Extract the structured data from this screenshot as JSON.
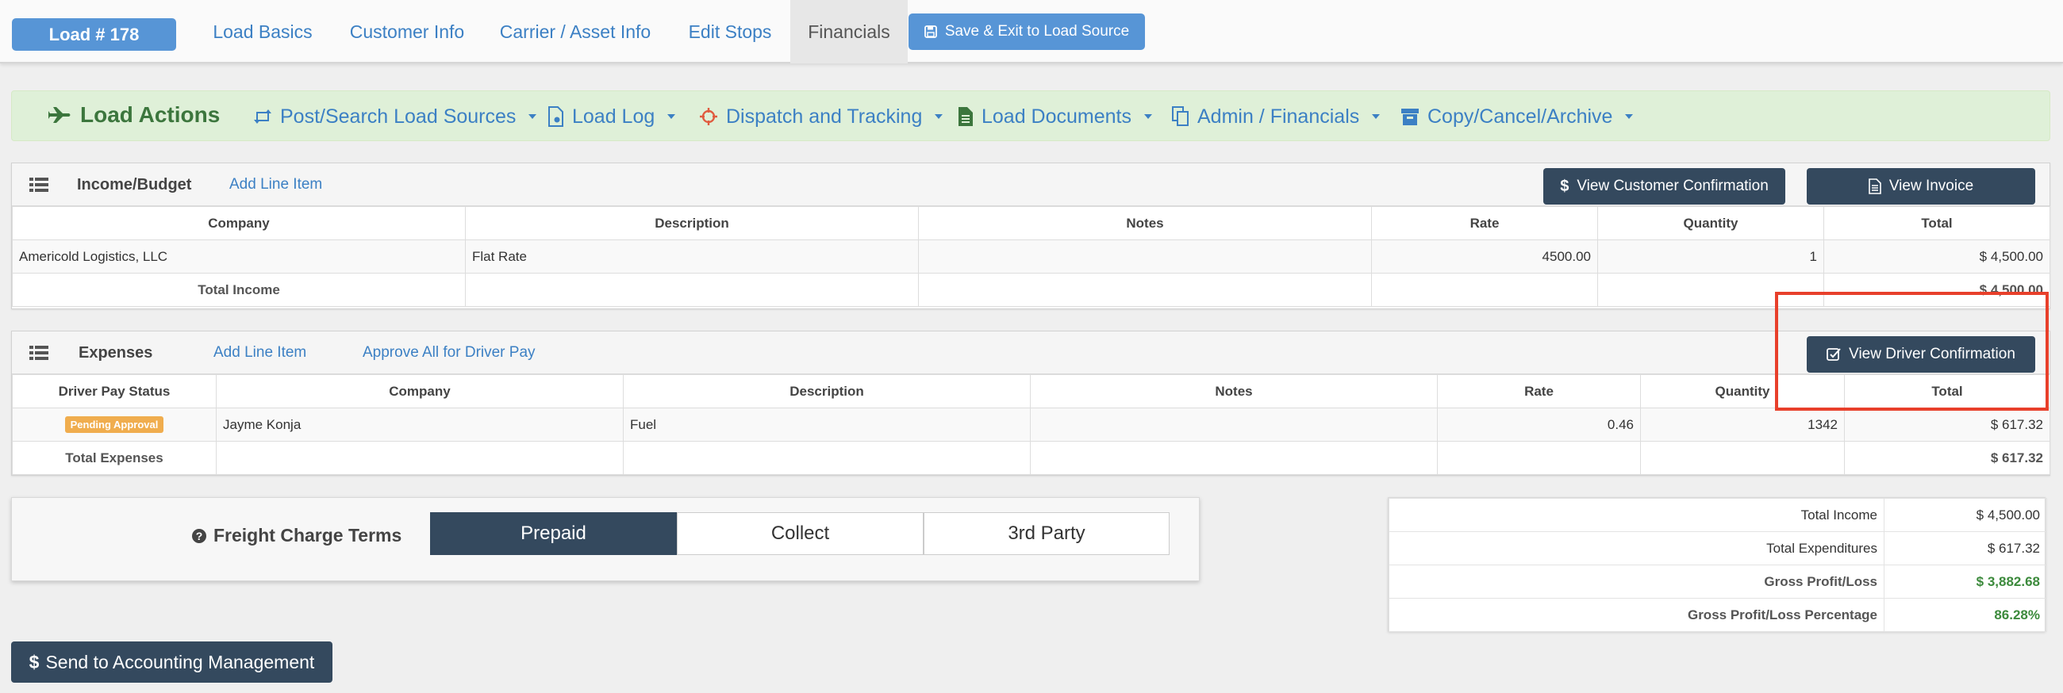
{
  "topnav": {
    "load_badge": "Load # 178",
    "tabs": [
      "Load Basics",
      "Customer Info",
      "Carrier / Asset Info",
      "Edit Stops",
      "Financials"
    ],
    "active_tab": "Financials",
    "save_exit": "Save & Exit to Load Source"
  },
  "load_actions": {
    "title": "Load Actions",
    "items": [
      "Post/Search Load Sources",
      "Load Log",
      "Dispatch and Tracking",
      "Load Documents",
      "Admin / Financials",
      "Copy/Cancel/Archive"
    ]
  },
  "income": {
    "title": "Income/Budget",
    "add_line": "Add Line Item",
    "view_customer_conf": "View Customer Confirmation",
    "view_invoice": "View Invoice",
    "columns": [
      "Company",
      "Description",
      "Notes",
      "Rate",
      "Quantity",
      "Total"
    ],
    "rows": [
      {
        "company": "Americold Logistics, LLC",
        "description": "Flat Rate",
        "notes": "",
        "rate": "4500.00",
        "quantity": "1",
        "total": "$ 4,500.00"
      }
    ],
    "footer_label": "Total Income",
    "footer_total": "$ 4,500.00"
  },
  "expenses": {
    "title": "Expenses",
    "add_line": "Add Line Item",
    "approve_all": "Approve All for Driver Pay",
    "view_driver_conf": "View Driver Confirmation",
    "columns": [
      "Driver Pay Status",
      "Company",
      "Description",
      "Notes",
      "Rate",
      "Quantity",
      "Total"
    ],
    "rows": [
      {
        "status": "Pending Approval",
        "company": "Jayme Konja",
        "description": "Fuel",
        "notes": "",
        "rate": "0.46",
        "quantity": "1342",
        "total": "$ 617.32"
      }
    ],
    "footer_label": "Total Expenses",
    "footer_total": "$ 617.32"
  },
  "freight_terms": {
    "label": "Freight Charge Terms",
    "options": [
      "Prepaid",
      "Collect",
      "3rd Party"
    ],
    "selected": "Prepaid"
  },
  "summary": {
    "rows": [
      {
        "label": "Total Income",
        "value": "$ 4,500.00"
      },
      {
        "label": "Total Expenditures",
        "value": "$ 617.32"
      },
      {
        "label": "Gross Profit/Loss",
        "value": "$ 3,882.68"
      },
      {
        "label": "Gross Profit/Loss Percentage",
        "value": "86.28%"
      }
    ]
  },
  "send_to_accounting": "Send to Accounting Management",
  "colors": {
    "primary": "#5795d6",
    "dark_button": "#34495e",
    "link": "#3c80c4",
    "success_bg": "#dff0d8",
    "success_text": "#3c763d",
    "warning": "#f0ad4e",
    "highlight": "#e8402b"
  }
}
